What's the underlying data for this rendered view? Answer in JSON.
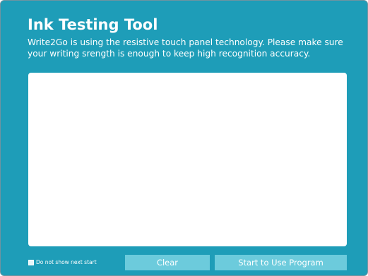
{
  "dialog": {
    "title": "Ink Testing Tool",
    "description": "Write2Go is using the resistive touch panel technology. Please make sure your writing srength is enough to keep high recognition accuracy."
  },
  "footer": {
    "checkbox_label": "Do not show next start",
    "checkbox_checked": false,
    "clear_label": "Clear",
    "start_label": "Start to Use Program"
  },
  "colors": {
    "panel_background": "#1e9db8",
    "button_background": "#6ccbdc",
    "canvas_background": "#ffffff",
    "text": "#ffffff"
  }
}
